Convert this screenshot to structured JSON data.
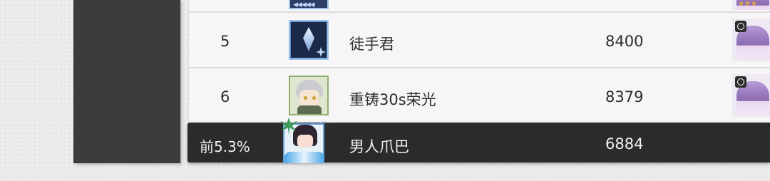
{
  "leaderboard": {
    "rows": [
      {
        "rank": "",
        "name": "",
        "score": ""
      },
      {
        "rank": "5",
        "name": "徒手君",
        "score": "8400"
      },
      {
        "rank": "6",
        "name": "重铸30s荣光",
        "score": "8379"
      }
    ],
    "self": {
      "rank": "前5.3%",
      "name": "男人爪巴",
      "score": "6884"
    }
  },
  "colors": {
    "accent_dark": "#2b2b2b",
    "panel": "#3c3c3c",
    "board": "#f6f6f6",
    "star": "#e7a531"
  },
  "icons": {
    "row5_avatar": "crystal-blade-avatar-icon",
    "row6_avatar": "chibi-character-avatar-icon",
    "self_avatar": "beach-character-avatar-icon",
    "team_target": "crosshair-icon"
  }
}
